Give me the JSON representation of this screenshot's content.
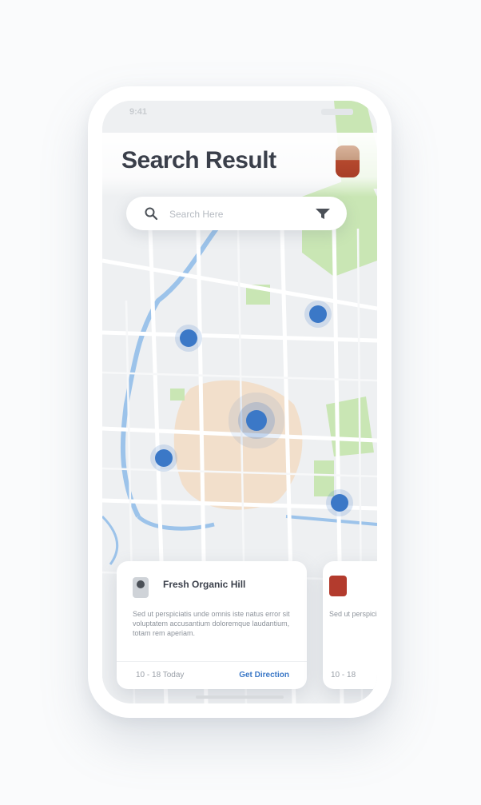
{
  "status_bar": {
    "time": "9:41"
  },
  "header": {
    "title": "Search Result"
  },
  "search": {
    "placeholder": "Search Here"
  },
  "cards": [
    {
      "title": "Fresh Organic Hill",
      "description": "Sed ut perspiciatis unde omnis iste natus error sit voluptatem accusantium doloremque laudantium, totam rem aperiam.",
      "hours": "10 - 18 Today",
      "action": "Get Direction"
    },
    {
      "description": "Sed ut perspiciatis",
      "hours": "10 - 18"
    }
  ],
  "colors": {
    "accent": "#3b78c7",
    "park": "#c9e6b4",
    "river": "#9cc3ea",
    "area": "#f2dcc4"
  }
}
